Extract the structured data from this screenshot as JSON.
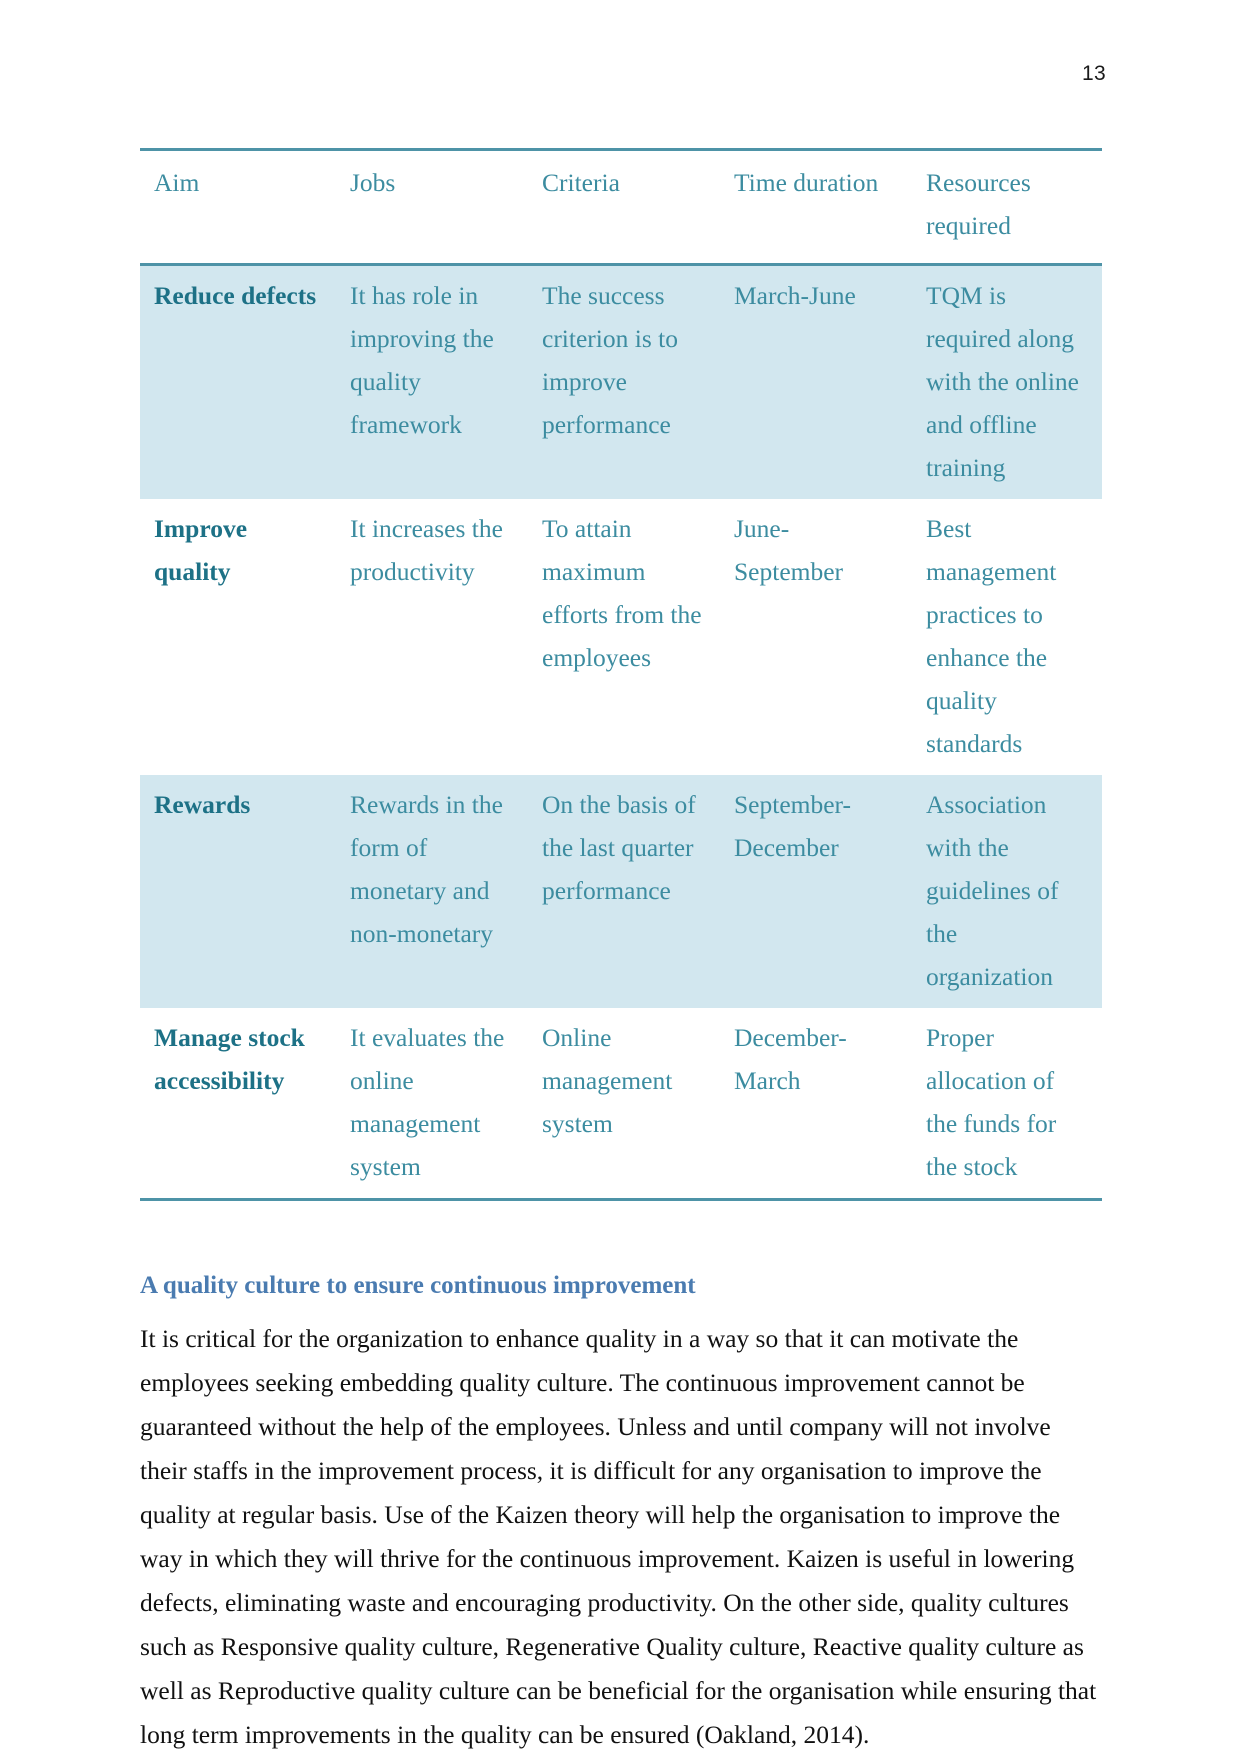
{
  "page": {
    "number": "13"
  },
  "table": {
    "columns": [
      "Aim",
      "Jobs",
      "Criteria",
      "Time duration",
      "Resources required"
    ],
    "rows": [
      {
        "aim": "Reduce defects",
        "jobs": "It has role in improving the quality framework",
        "criteria": "The success criterion is to improve performance",
        "time_duration": "March-June",
        "resources": "TQM is required along with the online and offline training",
        "shaded": true
      },
      {
        "aim": "Improve quality",
        "jobs": "It increases the productivity",
        "criteria": "To attain maximum efforts from the employees",
        "time_duration": "June-September",
        "resources": "Best management practices to enhance the quality standards",
        "shaded": false
      },
      {
        "aim": "Rewards",
        "jobs": "Rewards in the form of monetary and non-monetary",
        "criteria": "On the basis of the last quarter performance",
        "time_duration": "September-December",
        "resources": "Association with the guidelines of the organization",
        "shaded": true
      },
      {
        "aim": "Manage stock accessibility",
        "jobs": "It evaluates the online management system",
        "criteria": "Online management system",
        "time_duration": "December-March",
        "resources": "Proper allocation of the funds for the stock",
        "shaded": false
      }
    ]
  },
  "section": {
    "heading": "A quality culture to ensure continuous improvement",
    "paragraph": "It is critical for the organization to enhance quality in a way so that it can motivate the employees seeking embedding quality culture. The continuous improvement cannot be guaranteed without the help of the employees. Unless and until company will not involve their staffs in the improvement process, it is difficult for any organisation to improve the quality at regular basis. Use of the Kaizen theory will help the organisation to improve the way in which they will thrive for the continuous improvement. Kaizen is useful in lowering defects, eliminating waste and encouraging productivity. On the other side, quality cultures such as Responsive quality culture, Regenerative Quality culture, Reactive quality culture as well as Reproductive quality culture can be beneficial for the organisation while ensuring that long term improvements in the quality can be ensured (Oakland, 2014)."
  },
  "colors": {
    "table_text": "#3C8CA0",
    "table_aim_text": "#1D7186",
    "table_rule": "#4E93A7",
    "row_shade": "#D2E7EF",
    "heading": "#4A7BB0",
    "body_text": "#111111"
  }
}
